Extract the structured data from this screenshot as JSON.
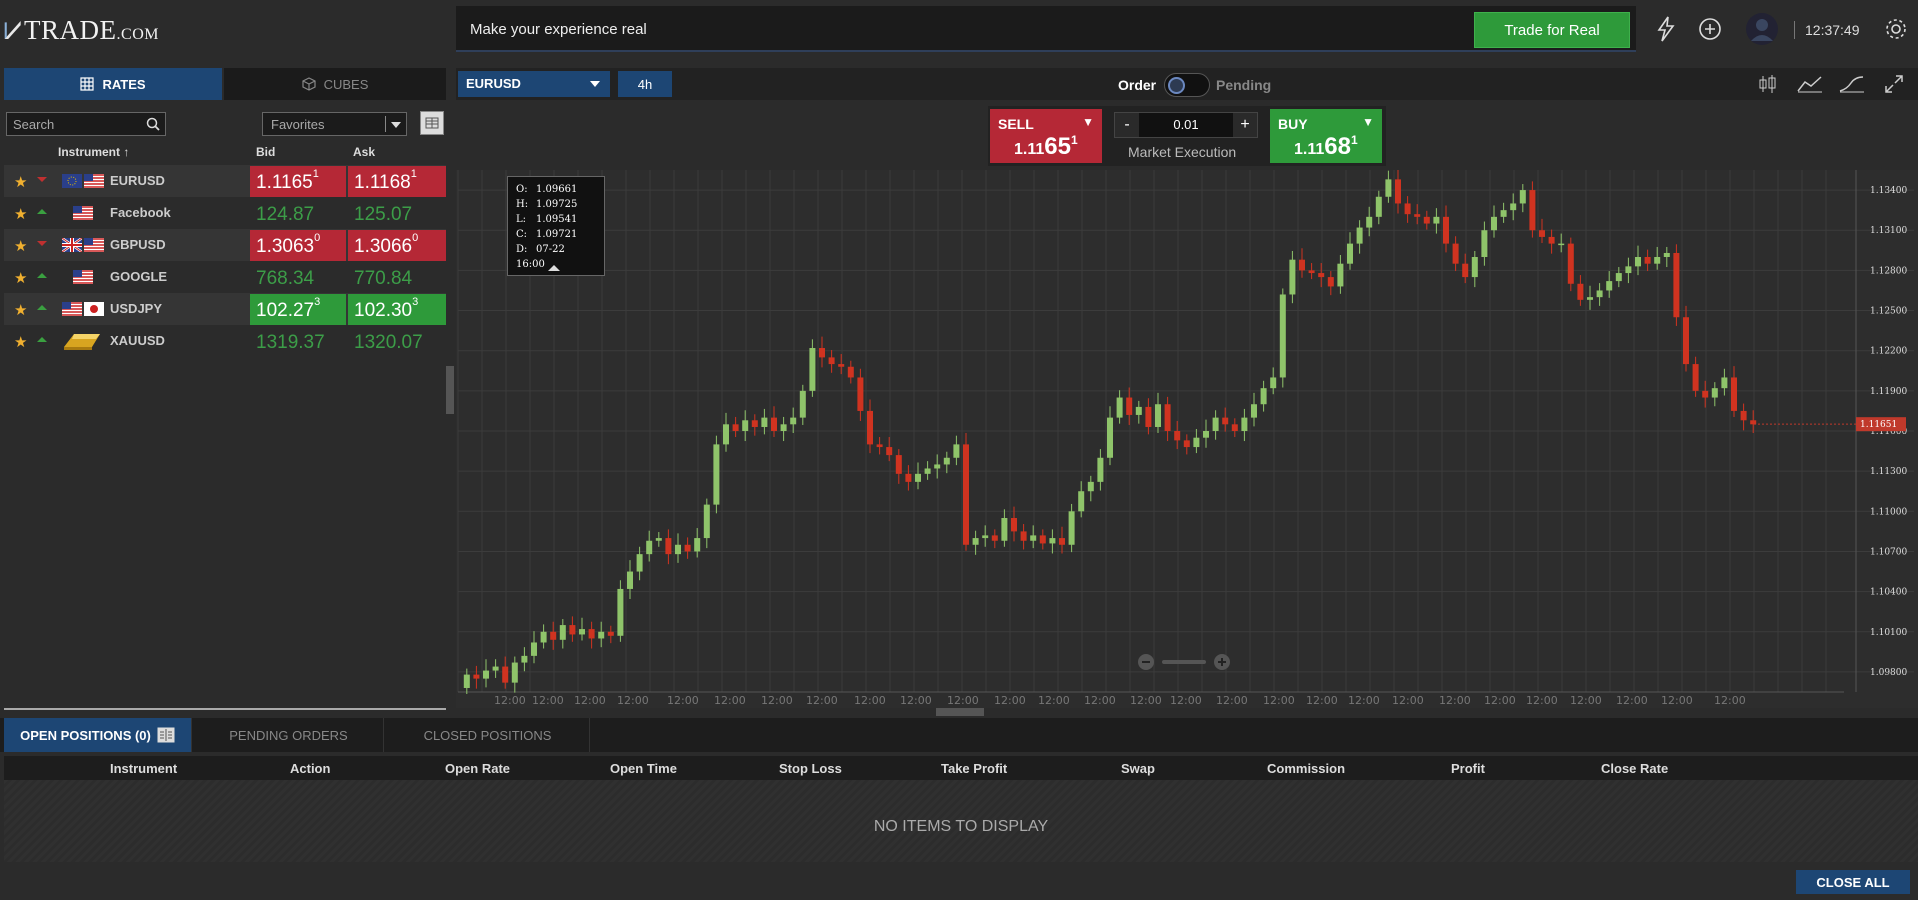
{
  "header": {
    "logo_text": "TRADE",
    "logo_suffix": ".COM",
    "banner_message": "Make your experience real",
    "trade_real_label": "Trade for Real",
    "clock": "12:37:49",
    "icons": [
      "lightning-icon",
      "plus-circle-icon",
      "user-avatar-icon",
      "gear-icon"
    ]
  },
  "left_panel": {
    "tabs": [
      {
        "label": "RATES",
        "icon": "grid-icon"
      },
      {
        "label": "CUBES",
        "icon": "cube-icon"
      }
    ],
    "search_placeholder": "Search",
    "filter_value": "Favorites",
    "columns": {
      "instrument": "Instrument",
      "bid": "Bid",
      "ask": "Ask"
    },
    "instruments": [
      {
        "name": "EURUSD",
        "trend": "down",
        "bid_main": "1.1165",
        "bid_sup": "1",
        "ask_main": "1.1168",
        "ask_sup": "1",
        "state": "red"
      },
      {
        "name": "Facebook",
        "trend": "up",
        "bid_main": "124.87",
        "bid_sup": "",
        "ask_main": "125.07",
        "ask_sup": "",
        "state": "plain"
      },
      {
        "name": "GBPUSD",
        "trend": "down",
        "bid_main": "1.3063",
        "bid_sup": "0",
        "ask_main": "1.3066",
        "ask_sup": "0",
        "state": "red"
      },
      {
        "name": "GOOGLE",
        "trend": "up",
        "bid_main": "768.34",
        "bid_sup": "",
        "ask_main": "770.84",
        "ask_sup": "",
        "state": "plain"
      },
      {
        "name": "USDJPY",
        "trend": "up",
        "bid_main": "102.27",
        "bid_sup": "3",
        "ask_main": "102.30",
        "ask_sup": "3",
        "state": "green"
      },
      {
        "name": "XAUUSD",
        "trend": "up",
        "bid_main": "1319.37",
        "bid_sup": "",
        "ask_main": "1320.07",
        "ask_sup": "",
        "state": "plain"
      }
    ]
  },
  "chart_toolbar": {
    "symbol": "EURUSD",
    "timeframe": "4h",
    "order_label": "Order",
    "pending_label": "Pending",
    "tools": [
      "candlestick-icon",
      "line-chart-icon",
      "indicator-icon",
      "fullscreen-icon"
    ]
  },
  "trade_panel": {
    "sell_label": "SELL",
    "sell_prefix": "1.11",
    "sell_big": "65",
    "sell_sup": "1",
    "buy_label": "BUY",
    "buy_prefix": "1.11",
    "buy_big": "68",
    "buy_sup": "1",
    "lot_minus": "-",
    "lot_value": "0.01",
    "lot_plus": "+",
    "execution": "Market Execution"
  },
  "ohlc_tooltip": {
    "O": "1.09661",
    "H": "1.09725",
    "L": "1.09541",
    "C": "1.09721",
    "D": "07-22 16:00"
  },
  "chart_data": {
    "type": "candlestick",
    "symbol": "EURUSD",
    "y_ticks": [
      "1.13400",
      "1.13100",
      "1.12800",
      "1.12500",
      "1.12200",
      "1.11900",
      "1.11600",
      "1.11300",
      "1.11000",
      "1.10700",
      "1.10400",
      "1.10100",
      "1.09800"
    ],
    "ylim": [
      1.0965,
      1.1355
    ],
    "x_tick_label": "12:00",
    "current_price": "1.11651",
    "closes": [
      1.0978,
      1.0975,
      1.0981,
      1.0984,
      1.0972,
      1.0987,
      1.0992,
      1.1002,
      1.101,
      1.1004,
      1.1015,
      1.1008,
      1.1012,
      1.1005,
      1.101,
      1.1007,
      1.1042,
      1.1055,
      1.1068,
      1.1078,
      1.108,
      1.1068,
      1.1075,
      1.107,
      1.108,
      1.1105,
      1.115,
      1.1165,
      1.116,
      1.1168,
      1.1163,
      1.117,
      1.116,
      1.1165,
      1.117,
      1.119,
      1.1222,
      1.1215,
      1.121,
      1.1208,
      1.12,
      1.1175,
      1.115,
      1.1148,
      1.1142,
      1.1128,
      1.1122,
      1.1128,
      1.1132,
      1.1135,
      1.114,
      1.115,
      1.1075,
      1.108,
      1.1082,
      1.1078,
      1.1095,
      1.1085,
      1.1078,
      1.1082,
      1.1076,
      1.108,
      1.1075,
      1.11,
      1.1115,
      1.1122,
      1.114,
      1.117,
      1.1185,
      1.1172,
      1.1178,
      1.1163,
      1.118,
      1.116,
      1.1153,
      1.1148,
      1.1155,
      1.116,
      1.117,
      1.1165,
      1.116,
      1.117,
      1.118,
      1.1192,
      1.12,
      1.1262,
      1.1288,
      1.128,
      1.1278,
      1.1275,
      1.1268,
      1.1285,
      1.13,
      1.1312,
      1.132,
      1.1335,
      1.1348,
      1.133,
      1.1322,
      1.132,
      1.1315,
      1.132,
      1.13,
      1.1285,
      1.1275,
      1.129,
      1.131,
      1.132,
      1.1325,
      1.133,
      1.134,
      1.131,
      1.1305,
      1.13,
      1.13,
      1.127,
      1.1258,
      1.126,
      1.1265,
      1.1272,
      1.1278,
      1.1283,
      1.129,
      1.1285,
      1.129,
      1.1293,
      1.1245,
      1.121,
      1.119,
      1.1185,
      1.1192,
      1.12,
      1.1175,
      1.1168,
      1.1165
    ]
  },
  "bottom_panel": {
    "tabs": {
      "open": "OPEN POSITIONS (0)",
      "pending": "PENDING ORDERS",
      "closed": "CLOSED POSITIONS"
    },
    "columns": [
      "Instrument",
      "Action",
      "Open Rate",
      "Open Time",
      "Stop Loss",
      "Take Profit",
      "Swap",
      "Commission",
      "Profit",
      "Close Rate"
    ],
    "empty_message": "NO ITEMS TO DISPLAY",
    "close_all": "CLOSE ALL"
  }
}
